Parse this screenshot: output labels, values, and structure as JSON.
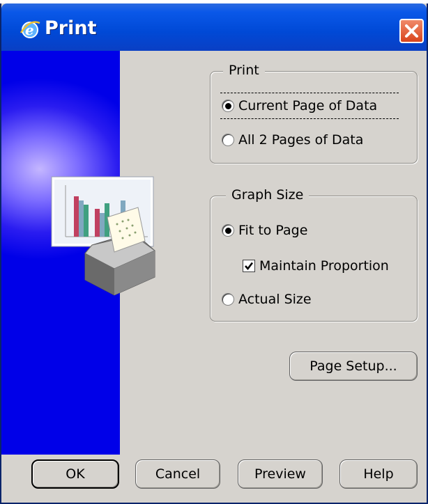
{
  "window": {
    "title": "Print",
    "title_icon": "ie-logo-icon",
    "close_icon": "close-icon"
  },
  "print_group": {
    "label": "Print",
    "options": [
      {
        "label": "Current Page of Data",
        "selected": true
      },
      {
        "label": "All 2 Pages of Data",
        "selected": false
      }
    ]
  },
  "graph_size_group": {
    "label": "Graph Size",
    "fit_to_page": {
      "label": "Fit to Page",
      "selected": true
    },
    "maintain_proportion": {
      "label": "Maintain Proportion",
      "checked": true
    },
    "actual_size": {
      "label": "Actual Size",
      "selected": false
    }
  },
  "buttons": {
    "page_setup": "Page Setup...",
    "ok": "OK",
    "cancel": "Cancel",
    "preview": "Preview",
    "help": "Help"
  },
  "colors": {
    "title_bar": "#0049d6",
    "dialog_bg": "#d6d3ce",
    "side_panel": "#0000e8",
    "close_button": "#d9441c"
  }
}
